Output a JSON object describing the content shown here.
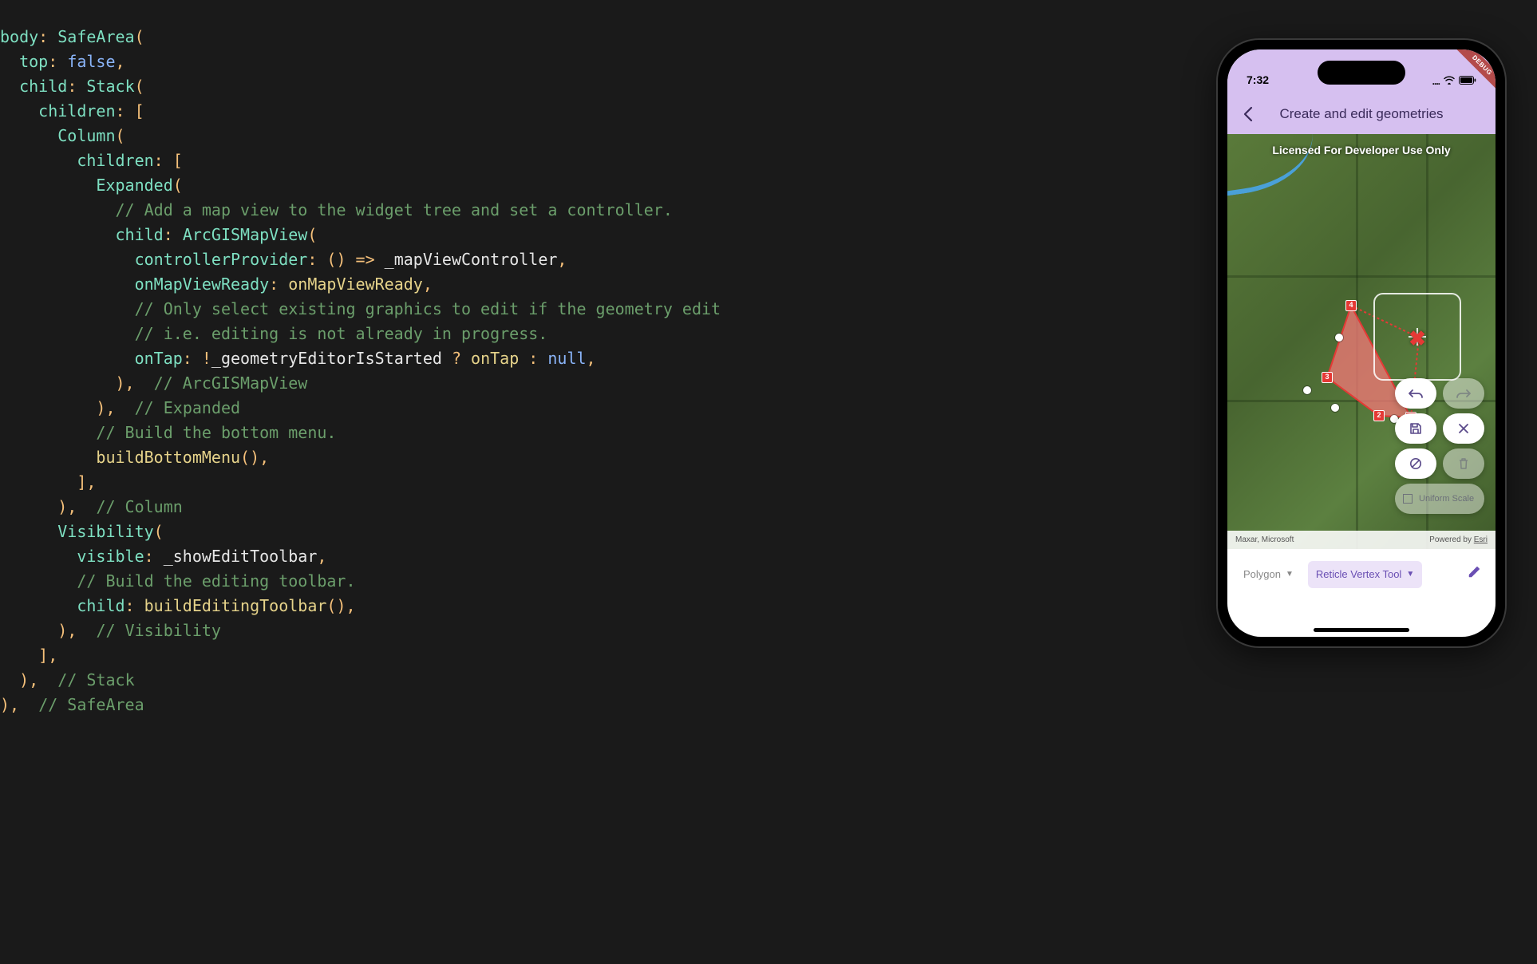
{
  "code": {
    "l1_body": "body",
    "l1_class": "SafeArea",
    "l2_top": "top",
    "l2_false": "false",
    "l3_child": "child",
    "l3_class": "Stack",
    "l4_children": "children",
    "l5_class": "Column",
    "l6_children": "children",
    "l7_class": "Expanded",
    "l8_comment": "// Add a map view to the widget tree and set a controller.",
    "l9_child": "child",
    "l9_class": "ArcGISMapView",
    "l10_prop": "controllerProvider",
    "l10_var": "_mapViewController",
    "l11_prop": "onMapViewReady",
    "l11_val": "onMapViewReady",
    "l12_comment": "// Only select existing graphics to edit if the geometry edit",
    "l13_comment": "// i.e. editing is not already in progress.",
    "l14_prop": "onTap",
    "l14_var": "_geometryEditorIsStarted",
    "l14_then": "onTap",
    "l14_else": "null",
    "l15_end_comment": "// ArcGISMapView",
    "l16_end_comment": "// Expanded",
    "l17_comment": "// Build the bottom menu.",
    "l18_call": "buildBottomMenu",
    "l20_end_comment": "// Column",
    "l21_class": "Visibility",
    "l22_prop": "visible",
    "l22_var": "_showEditToolbar",
    "l23_comment": "// Build the editing toolbar.",
    "l24_child": "child",
    "l24_call": "buildEditingToolbar",
    "l25_end_comment": "// Visibility",
    "l27_end_comment": "// Stack",
    "l28_end_comment": "// SafeArea"
  },
  "phone": {
    "debug": "DEBUG",
    "time": "7:32",
    "status_dots": "....",
    "appbar_title": "Create and edit geometries",
    "overlay": "Licensed For Developer Use Only",
    "vertex1": "1",
    "vertex2": "2",
    "vertex3": "3",
    "vertex4": "4",
    "attribution_left": "Maxar, Microsoft",
    "attribution_right_prefix": "Powered by ",
    "attribution_right_link": "Esri",
    "geom_dropdown": "Polygon",
    "tool_dropdown": "Reticle Vertex Tool",
    "uniform_label": "Uniform Scale"
  }
}
